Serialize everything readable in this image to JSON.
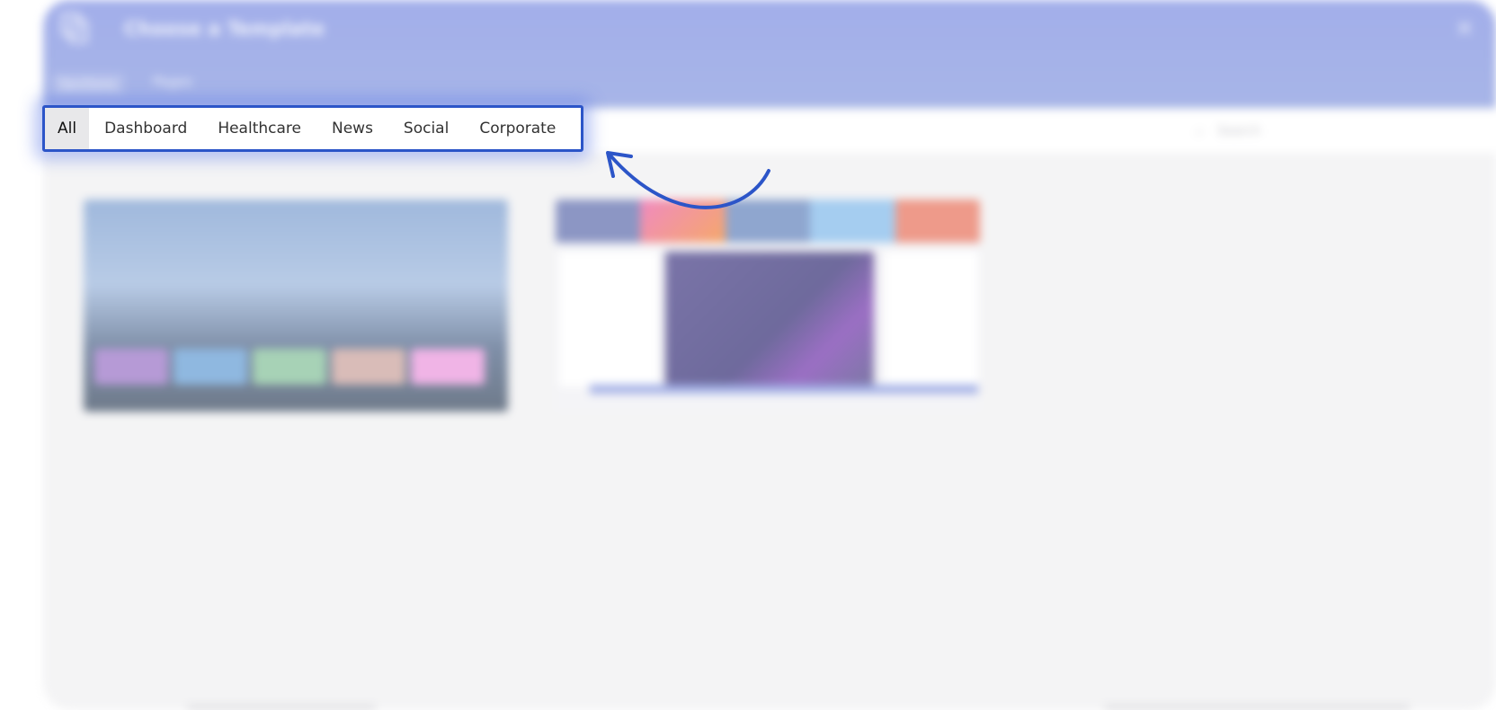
{
  "dialog": {
    "title": "Choose a Template",
    "close_icon": "close-icon",
    "tabs": [
      {
        "label": "Sections"
      },
      {
        "label": "Pages"
      }
    ],
    "search_placeholder": "Search"
  },
  "categories": {
    "active_index": 0,
    "items": [
      {
        "label": "All"
      },
      {
        "label": "Dashboard"
      },
      {
        "label": "Healthcare"
      },
      {
        "label": "News"
      },
      {
        "label": "Social"
      },
      {
        "label": "Corporate"
      }
    ]
  },
  "colors": {
    "highlight": "#2c55c8",
    "header": "#a2aeea",
    "arrow": "#2c55c8"
  }
}
